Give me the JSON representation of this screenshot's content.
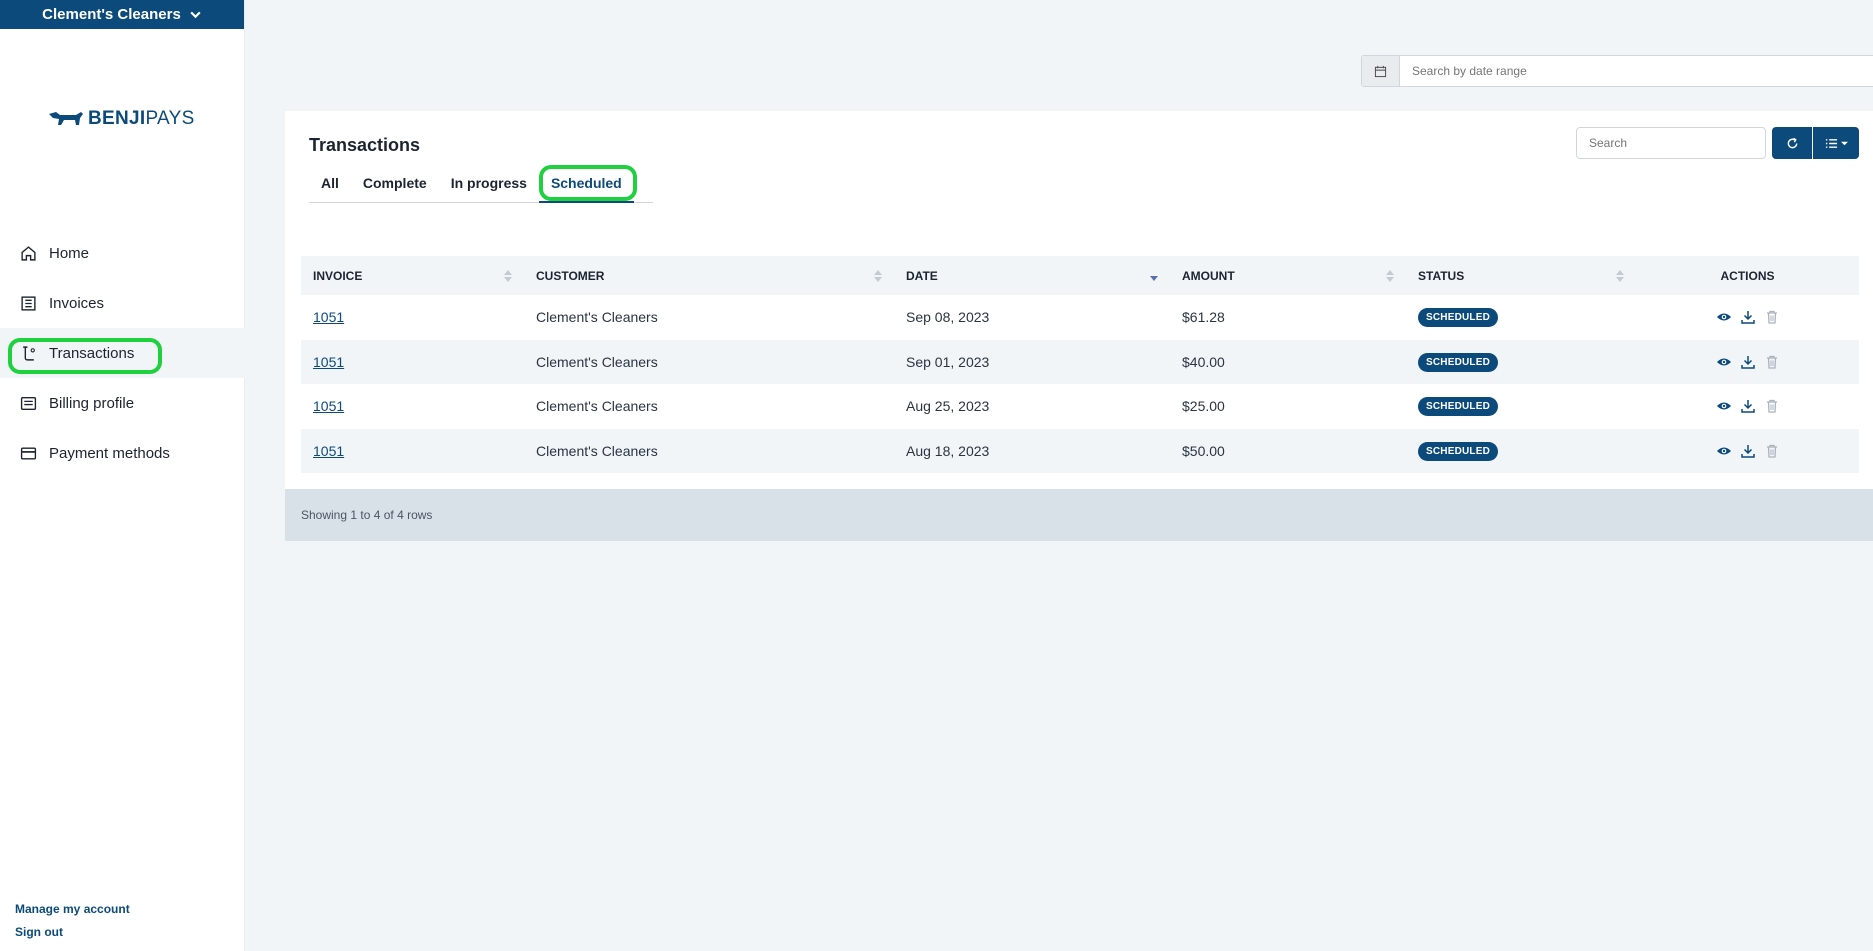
{
  "org": {
    "name": "Clement's Cleaners"
  },
  "logo": {
    "bold": "BENJI",
    "light": "PAYS"
  },
  "nav": [
    {
      "label": "Home",
      "icon": "home-icon"
    },
    {
      "label": "Invoices",
      "icon": "invoice-icon"
    },
    {
      "label": "Transactions",
      "icon": "transactions-icon"
    },
    {
      "label": "Billing profile",
      "icon": "billing-icon"
    },
    {
      "label": "Payment methods",
      "icon": "card-icon"
    }
  ],
  "bottom": {
    "manage": "Manage my account",
    "signout": "Sign out"
  },
  "daterange": {
    "placeholder": "Search by date range"
  },
  "card": {
    "title": "Transactions",
    "search_placeholder": "Search",
    "tabs": [
      "All",
      "Complete",
      "In progress",
      "Scheduled"
    ],
    "active_tab": "Scheduled"
  },
  "table": {
    "headers": [
      "INVOICE",
      "CUSTOMER",
      "DATE",
      "AMOUNT",
      "STATUS",
      "ACTIONS"
    ],
    "rows": [
      {
        "invoice": "1051",
        "customer": "Clement's Cleaners",
        "date": "Sep 08, 2023",
        "amount": "$61.28",
        "status": "SCHEDULED"
      },
      {
        "invoice": "1051",
        "customer": "Clement's Cleaners",
        "date": "Sep 01, 2023",
        "amount": "$40.00",
        "status": "SCHEDULED"
      },
      {
        "invoice": "1051",
        "customer": "Clement's Cleaners",
        "date": "Aug 25, 2023",
        "amount": "$25.00",
        "status": "SCHEDULED"
      },
      {
        "invoice": "1051",
        "customer": "Clement's Cleaners",
        "date": "Aug 18, 2023",
        "amount": "$50.00",
        "status": "SCHEDULED"
      }
    ],
    "footer": "Showing 1 to 4 of 4 rows"
  },
  "colors": {
    "brand": "#0b4a7a",
    "highlight": "#1fd03f"
  }
}
